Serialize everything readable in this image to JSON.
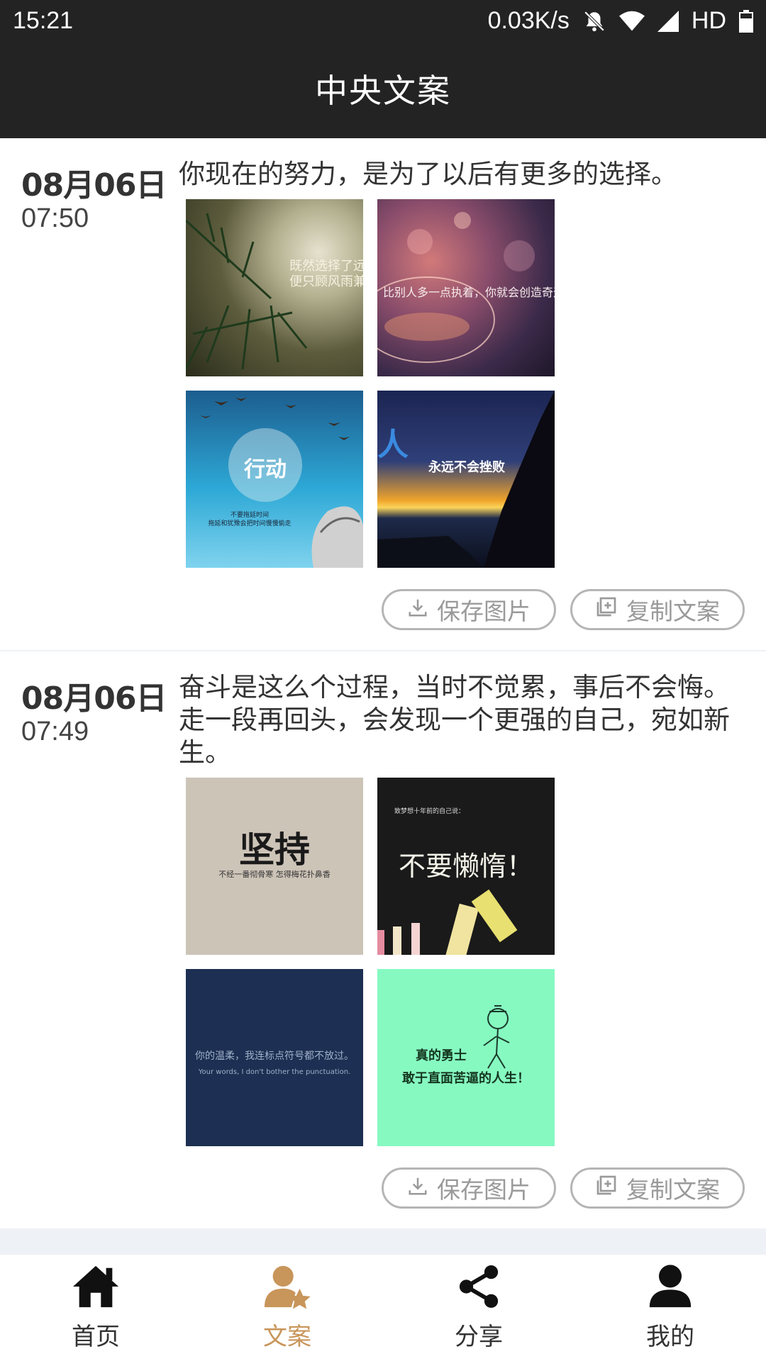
{
  "status_bar": {
    "time": "15:21",
    "net_speed": "0.03K/s",
    "hd": "HD"
  },
  "header": {
    "title": "中央文案"
  },
  "posts": [
    {
      "date": "08月06日",
      "time": "07:50",
      "text": "你现在的努力，是为了以后有更多的选择。",
      "images": [
        {
          "caption_lines": [
            "既然选择了远方",
            "便只顾风雨兼程"
          ]
        },
        {
          "caption_lines": [
            "比别人多一点执着，你就会创造奇迹"
          ]
        },
        {
          "caption_lines": [
            "行动"
          ],
          "sub_lines": [
            "不要拖延时间",
            "拖延和犹豫会把时间慢慢偷走"
          ]
        },
        {
          "caption_lines": [
            "人",
            "永远不会挫败"
          ]
        }
      ],
      "save_label": "保存图片",
      "copy_label": "复制文案"
    },
    {
      "date": "08月06日",
      "time": "07:49",
      "text": "奋斗是这么个过程，当时不觉累，事后不会悔。走一段再回头，会发现一个更强的自己，宛如新生。",
      "images": [
        {
          "caption_lines": [
            "坚持"
          ],
          "sub_lines": [
            "不经一番彻骨寒 怎得梅花扑鼻香"
          ]
        },
        {
          "caption_lines": [
            "致梦想十年前的自己说：",
            "不要懒惰！"
          ]
        },
        {
          "caption_lines": [
            "你的温柔，我连标点符号都不放过。",
            "Your words, I don't bother the punctuation."
          ]
        },
        {
          "caption_lines": [
            "真的勇士",
            "敢于直面苦逼的人生！"
          ]
        }
      ],
      "save_label": "保存图片",
      "copy_label": "复制文案"
    }
  ],
  "bottom_nav": {
    "items": [
      {
        "label": "首页",
        "icon": "home-icon"
      },
      {
        "label": "文案",
        "icon": "user-star-icon",
        "active": true
      },
      {
        "label": "分享",
        "icon": "share-icon"
      },
      {
        "label": "我的",
        "icon": "person-icon"
      }
    ]
  },
  "colors": {
    "header_bg": "#232323",
    "accent": "#c8955a",
    "button_border": "#b5b5b5",
    "feed_bg": "#eef1f5"
  }
}
